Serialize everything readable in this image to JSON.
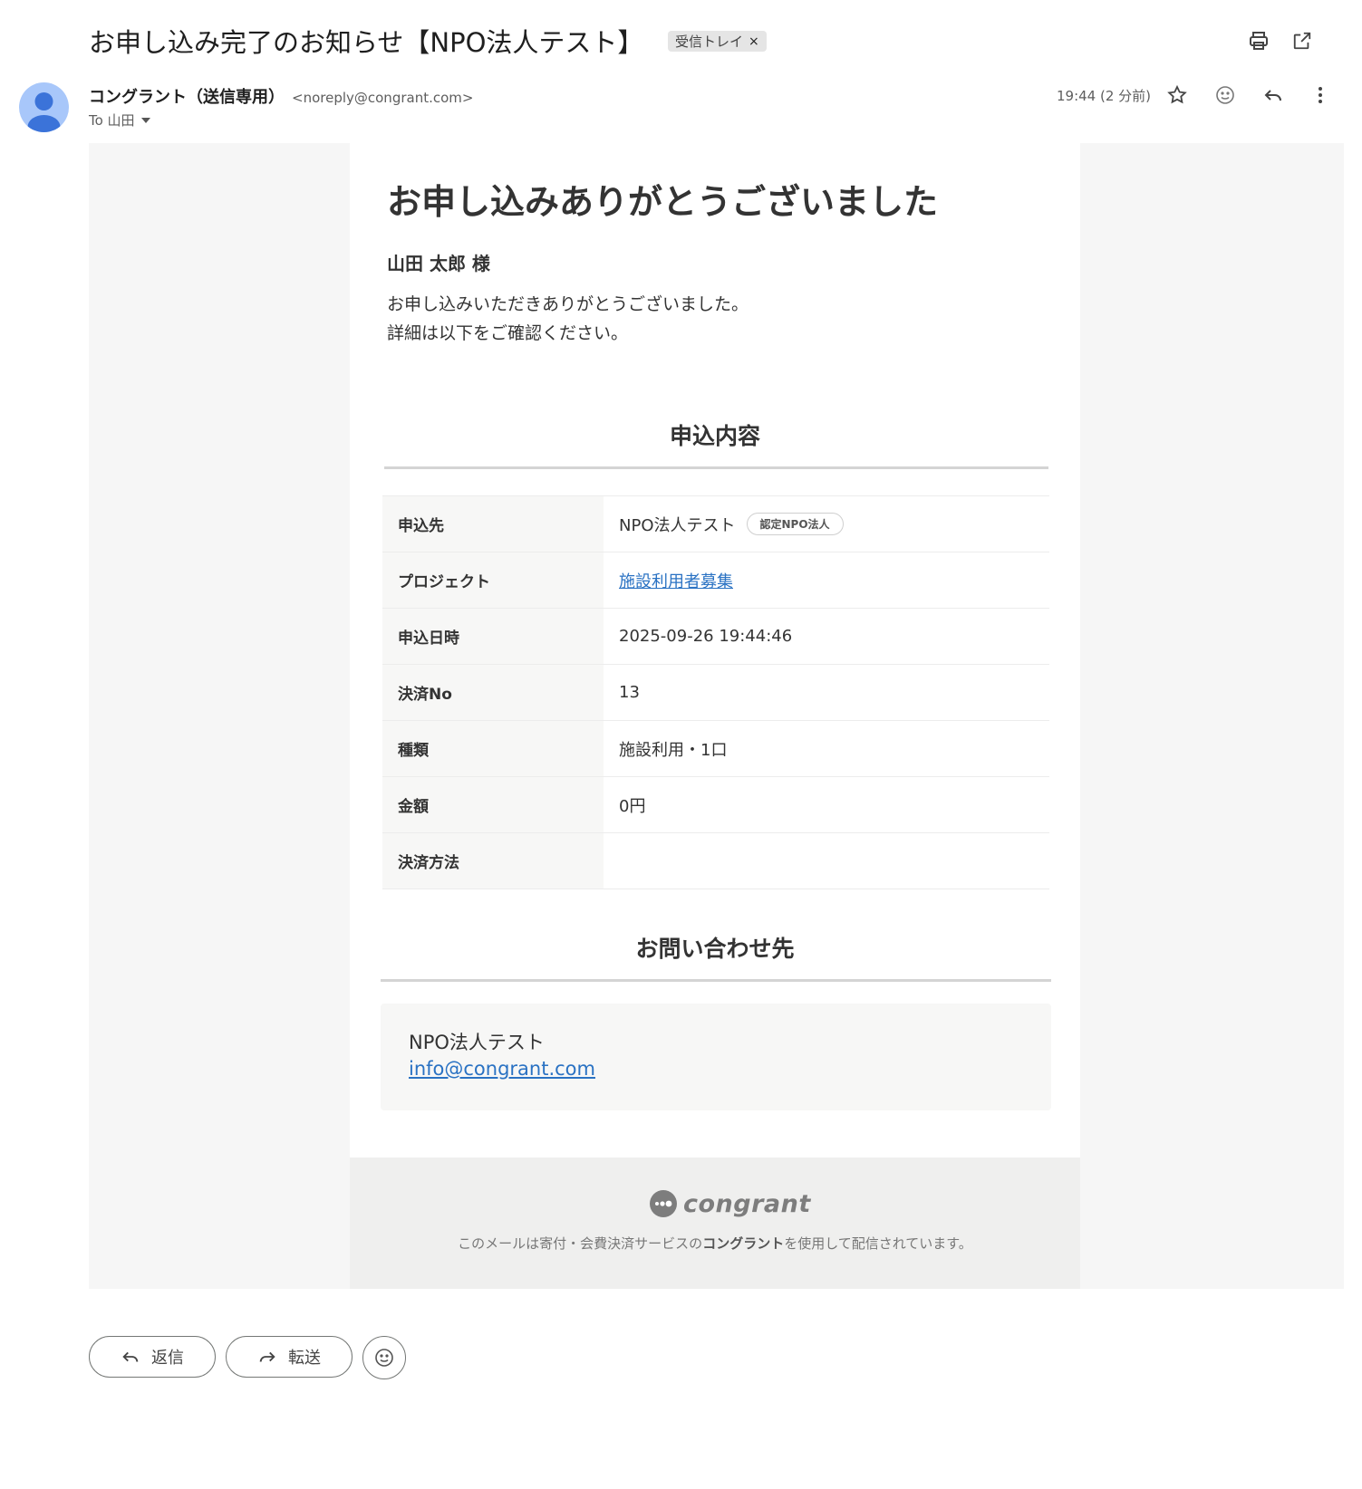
{
  "header": {
    "subject": "お申し込み完了のお知らせ【NPO法人テスト】",
    "label": "受信トレイ",
    "label_remove": "×"
  },
  "message": {
    "sender_name": "コングラント（送信専用）",
    "sender_email": "<noreply@congrant.com>",
    "recipient": "To 山田",
    "timestamp": "19:44 (2 分前)"
  },
  "email": {
    "title": "お申し込みありがとうございました",
    "recipient_name": "山田 太郎 様",
    "body_lines": [
      "お申し込みいただきありがとうございました。",
      "詳細は以下をご確認ください。"
    ],
    "details_heading": "申込内容",
    "details": [
      {
        "key": "申込先",
        "value": "NPO法人テスト",
        "badge": "認定NPO法人"
      },
      {
        "key": "プロジェクト",
        "value": "施設利用者募集"
      },
      {
        "key": "申込日時",
        "value": "2025-09-26 19:44:46"
      },
      {
        "key": "決済No",
        "value": "13"
      },
      {
        "key": "種類",
        "value": "施設利用・1口"
      },
      {
        "key": "金額",
        "value": "0円"
      },
      {
        "key": "決済方法",
        "value": ""
      }
    ],
    "contact_heading": "お問い合わせ先",
    "contact_name": "NPO法人テスト",
    "contact_email": "info@congrant.com",
    "logo_text": "congrant",
    "footer_prefix": "このメールは寄付・会費決済サービスの",
    "footer_brand": "コングラント",
    "footer_suffix": "を使用して配信されています。"
  },
  "actions": {
    "reply_label": "返信",
    "forward_label": "転送"
  },
  "colors": {
    "link": "#2a72c3",
    "avatar": "#a8c7fa",
    "avatar_figure": "#3b73d9"
  }
}
